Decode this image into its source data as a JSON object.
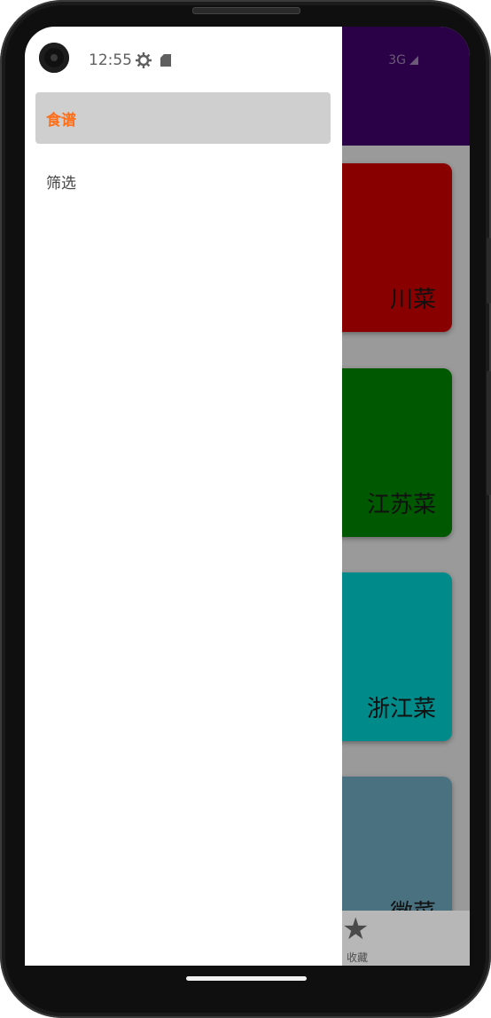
{
  "status_bar": {
    "time": "12:55",
    "network": "3G"
  },
  "drawer": {
    "items": [
      {
        "label": "食谱",
        "selected": true
      },
      {
        "label": "筛选",
        "selected": false
      }
    ]
  },
  "cards": [
    {
      "label": "川菜",
      "color": "#880000"
    },
    {
      "label": "江苏菜",
      "color": "#005800"
    },
    {
      "label": "浙江菜",
      "color": "#008a8a"
    },
    {
      "label": "徽菜",
      "color": "#4a717f"
    }
  ],
  "bottom_nav": {
    "favorite_label": "收藏"
  },
  "colors": {
    "accent": "#ff6f1a",
    "app_bar": "#2a0046"
  }
}
